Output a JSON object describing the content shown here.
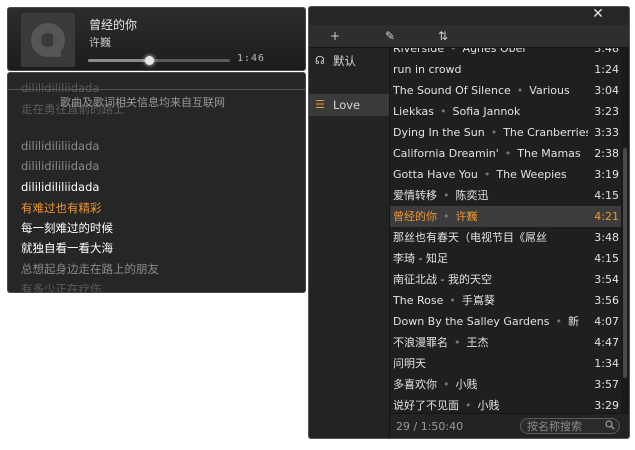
{
  "now_playing": {
    "title": "曾经的你",
    "artist": "许巍",
    "time": "1:46",
    "progress": 0.43
  },
  "lyrics": {
    "notice": "歌曲及歌词相关信息均来自互联网",
    "lines": [
      {
        "text": "dililidililiidada",
        "state": "faint"
      },
      {
        "text": "走在勇往直前的路上",
        "state": "faint"
      },
      {
        "text": "dililidililiidada",
        "state": "dim"
      },
      {
        "text": "dililidililiidada",
        "state": "dim"
      },
      {
        "text": "dililidililiidada",
        "state": "normal"
      },
      {
        "text": "有难过也有精彩",
        "state": "current"
      },
      {
        "text": "每一刻难过的时候",
        "state": "normal"
      },
      {
        "text": "就独自看一看大海",
        "state": "normal"
      },
      {
        "text": "总想起身边走在路上的朋友",
        "state": "dim"
      },
      {
        "text": "有多少正在疗伤",
        "state": "faint"
      },
      {
        "text": "dililidililiidada",
        "state": "faint"
      }
    ]
  },
  "playlist": {
    "close_label": "✕",
    "toolbar": {
      "add_label": "+",
      "edit_label": "✎",
      "sort_label": "⇅"
    },
    "sidebar": [
      {
        "label": "默认",
        "icon": "headphones-icon",
        "glyph": "☊",
        "active": false
      },
      {
        "label": "Love",
        "icon": "list-icon",
        "glyph": "☰",
        "active": true
      }
    ],
    "tracks": [
      {
        "title": "Riverside",
        "artist": "Agnes Obel",
        "duration": "3:48"
      },
      {
        "title": "run in crowd",
        "artist": "",
        "duration": "1:24"
      },
      {
        "title": "The Sound Of Silence",
        "artist": "Various",
        "duration": "3:04"
      },
      {
        "title": "Liekkas",
        "artist": "Sofia Jannok",
        "duration": "3:23"
      },
      {
        "title": "Dying In the Sun",
        "artist": "The Cranberries",
        "duration": "3:33"
      },
      {
        "title": "California Dreamin'",
        "artist": "The Mamas",
        "duration": "2:38"
      },
      {
        "title": "Gotta Have You",
        "artist": "The Weepies",
        "duration": "3:19"
      },
      {
        "title": "爱情转移",
        "artist": "陈奕迅",
        "duration": "4:15"
      },
      {
        "title": "曾经的你",
        "artist": "许巍",
        "duration": "4:21",
        "selected": true
      },
      {
        "title": "那丝也有春天（电视节目《屌丝",
        "artist": "",
        "duration": "3:48"
      },
      {
        "title": "李琦 - 知足",
        "artist": "",
        "duration": "4:15"
      },
      {
        "title": "南征北战 - 我的天空",
        "artist": "",
        "duration": "3:54"
      },
      {
        "title": "The Rose",
        "artist": "手嶌葵",
        "duration": "3:56"
      },
      {
        "title": "Down By the Salley Gardens",
        "artist": "新",
        "duration": "4:07"
      },
      {
        "title": "不浪漫罪名",
        "artist": "王杰",
        "duration": "4:47"
      },
      {
        "title": "问明天",
        "artist": "",
        "duration": "1:34"
      },
      {
        "title": "多喜欢你",
        "artist": "小贱",
        "duration": "3:57"
      },
      {
        "title": "说好了不见面",
        "artist": "小贱",
        "duration": "3:29"
      }
    ],
    "footer": {
      "count": "29 / 1:50:40",
      "search_placeholder": "按名称搜索"
    }
  }
}
